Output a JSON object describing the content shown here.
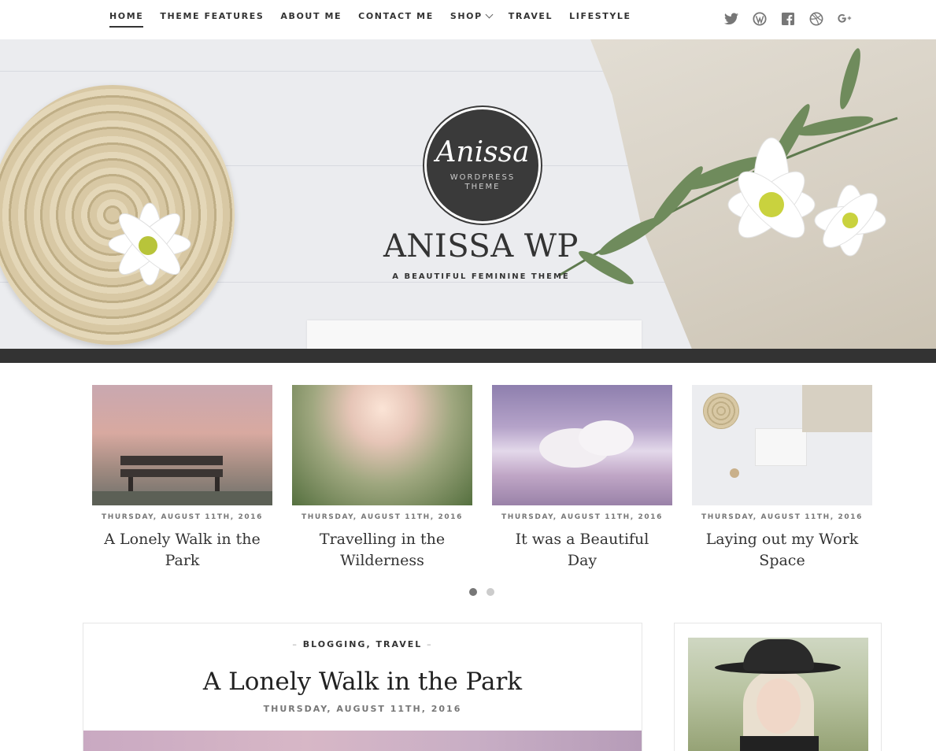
{
  "nav": {
    "items": [
      {
        "label": "HOME",
        "active": true
      },
      {
        "label": "THEME FEATURES"
      },
      {
        "label": "ABOUT ME"
      },
      {
        "label": "CONTACT ME"
      },
      {
        "label": "SHOP",
        "dropdown": true
      },
      {
        "label": "TRAVEL"
      },
      {
        "label": "LIFESTYLE"
      }
    ],
    "social": [
      "twitter-icon",
      "wordpress-icon",
      "facebook-icon",
      "dribbble-icon",
      "google-plus-icon"
    ]
  },
  "hero": {
    "logo_script": "Anissa",
    "logo_sub_1": "WORDPRESS",
    "logo_sub_2": "THEME",
    "site_title": "ANISSA WP",
    "tagline": "A BEAUTIFUL FEMININE THEME"
  },
  "slider": {
    "slides": [
      {
        "date": "THURSDAY, AUGUST 11TH, 2016",
        "title": "A Lonely Walk in the Park"
      },
      {
        "date": "THURSDAY, AUGUST 11TH, 2016",
        "title": "Travelling in the Wilderness"
      },
      {
        "date": "THURSDAY, AUGUST 11TH, 2016",
        "title": "It was a Beautiful Day"
      },
      {
        "date": "THURSDAY, AUGUST 11TH, 2016",
        "title": "Laying out my Work Space"
      }
    ],
    "pages": 2,
    "active_page": 1
  },
  "post": {
    "dash_left": "–",
    "cat_1": "BLOGGING",
    "comma": ",",
    "cat_2": "TRAVEL",
    "dash_right": "–",
    "title": "A Lonely Walk in the Park",
    "date": "THURSDAY, AUGUST 11TH, 2016"
  },
  "colors": {
    "text": "#333333",
    "hero_bar": "#333333",
    "muted": "#777777"
  }
}
